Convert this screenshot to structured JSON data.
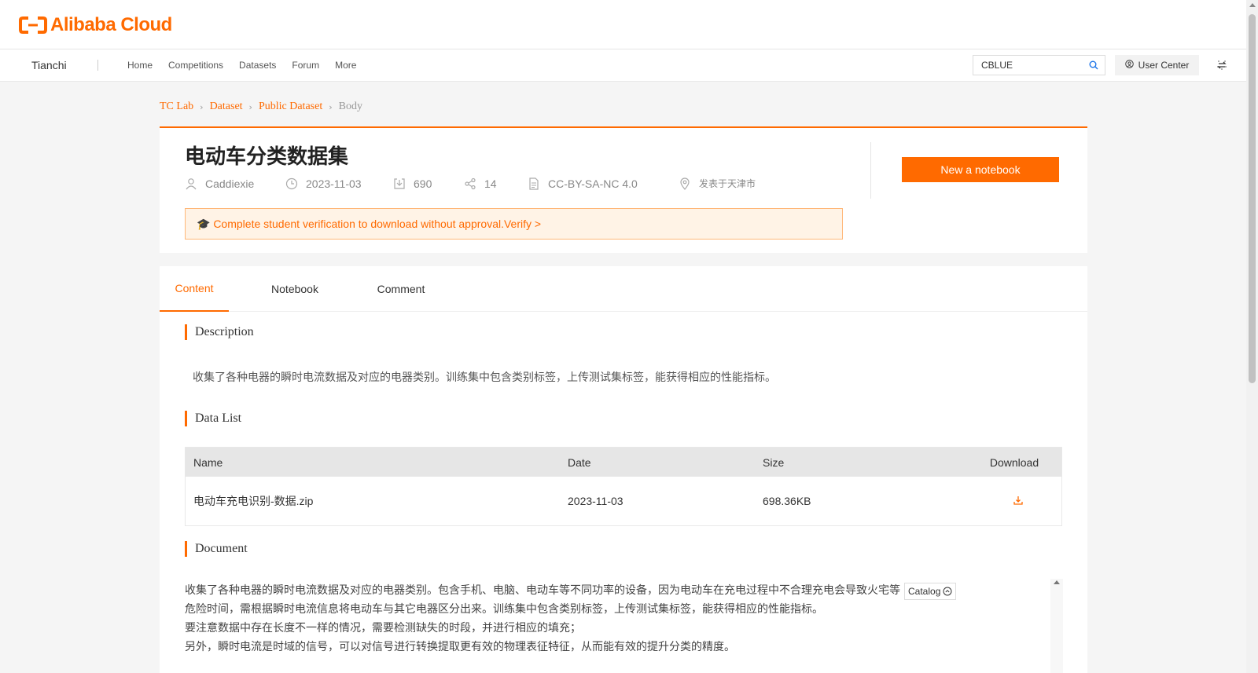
{
  "header": {
    "logo_text": "Alibaba Cloud"
  },
  "nav": {
    "brand": "Tianchi",
    "links": [
      "Home",
      "Competitions",
      "Datasets",
      "Forum",
      "More"
    ],
    "search_value": "CBLUE",
    "user_center": "User Center"
  },
  "breadcrumb": [
    "TC Lab",
    "Dataset",
    "Public Dataset",
    "Body"
  ],
  "dataset": {
    "title": "电动车分类数据集",
    "author": "Caddiexie",
    "date": "2023-11-03",
    "downloads": "690",
    "shares": "14",
    "license": "CC-BY-SA-NC 4.0",
    "location": "发表于天津市",
    "notice": "🎓 Complete student verification to download without approval.Verify >",
    "new_notebook": "New a notebook"
  },
  "tabs": [
    "Content",
    "Notebook",
    "Comment"
  ],
  "sections": {
    "description_title": "Description",
    "description_text": "收集了各种电器的瞬时电流数据及对应的电器类别。训练集中包含类别标签，上传测试集标签，能获得相应的性能指标。",
    "datalist_title": "Data List",
    "document_title": "Document"
  },
  "table": {
    "headers": [
      "Name",
      "Date",
      "Size",
      "Download"
    ],
    "rows": [
      {
        "name": "电动车充电识别-数据.zip",
        "date": "2023-11-03",
        "size": "698.36KB"
      }
    ]
  },
  "document": {
    "lines": [
      "收集了各种电器的瞬时电流数据及对应的电器类别。包含手机、电脑、电动车等不同功率的设备，因为电动车在充电过程中不合理充电会导致火宅等",
      "危险时间，需根据瞬时电流信息将电动车与其它电器区分出来。训练集中包含类别标签，上传测试集标签，能获得相应的性能指标。",
      "要注意数据中存在长度不一样的情况，需要检测缺失的时段，并进行相应的填充；",
      "另外，瞬时电流是时域的信号，可以对信号进行转换提取更有效的物理表征特征，从而能有效的提升分类的精度。"
    ],
    "catalog": "Catalog"
  },
  "colors": {
    "accent": "#ff6a00"
  }
}
